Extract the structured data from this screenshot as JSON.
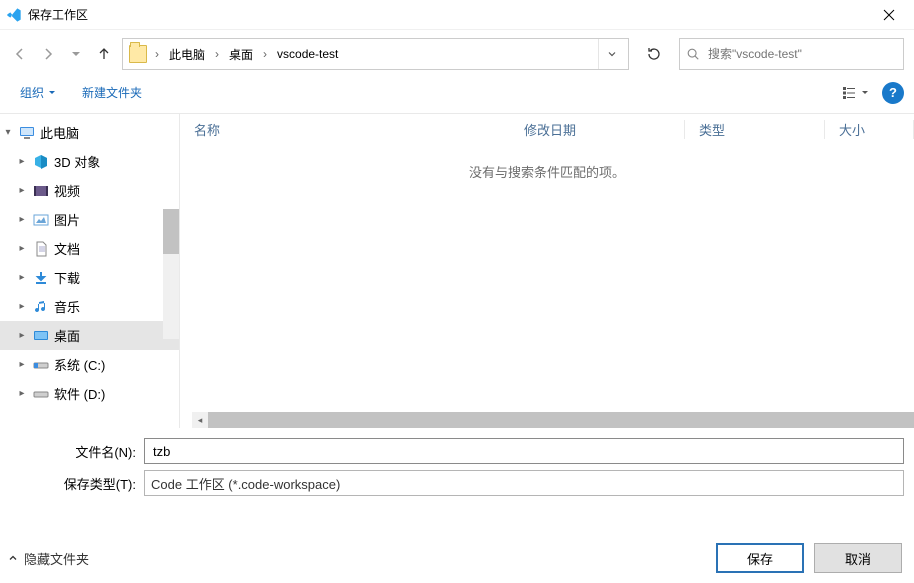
{
  "title": "保存工作区",
  "breadcrumbs": [
    "此电脑",
    "桌面",
    "vscode-test"
  ],
  "search_placeholder": "搜索\"vscode-test\"",
  "toolbar": {
    "organize": "组织",
    "new_folder": "新建文件夹"
  },
  "columns": {
    "name": "名称",
    "date": "修改日期",
    "type": "类型",
    "size": "大小"
  },
  "empty_message": "没有与搜索条件匹配的项。",
  "tree": {
    "root": "此电脑",
    "items": [
      {
        "label": "3D 对象"
      },
      {
        "label": "视频"
      },
      {
        "label": "图片"
      },
      {
        "label": "文档"
      },
      {
        "label": "下载"
      },
      {
        "label": "音乐"
      },
      {
        "label": "桌面"
      },
      {
        "label": "系统 (C:)"
      },
      {
        "label": "软件 (D:)"
      }
    ]
  },
  "form": {
    "filename_label": "文件名(N):",
    "filename_value": "tzb",
    "type_label": "保存类型(T):",
    "type_value": "Code 工作区 (*.code-workspace)"
  },
  "footer": {
    "hide_folders": "隐藏文件夹",
    "save": "保存",
    "cancel": "取消"
  }
}
